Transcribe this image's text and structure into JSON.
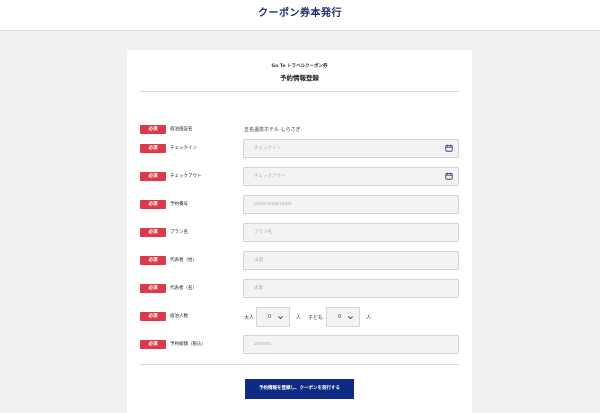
{
  "header": {
    "title": "クーポン券本発行"
  },
  "card": {
    "subtitle": "Go To トラベルクーポン券",
    "title": "予約情報登録"
  },
  "required_label": "必須",
  "fields": {
    "facility": {
      "label": "宿泊施設名",
      "value": "五名温泉ホテル しらさぎ"
    },
    "checkin": {
      "label": "チェックイン",
      "placeholder": "チェックイン",
      "icon": "calendar-icon"
    },
    "checkout": {
      "label": "チェックアウト",
      "placeholder": "チェックアウト",
      "icon": "calendar-icon"
    },
    "reservation_no": {
      "label": "予約番号",
      "placeholder": "0000-0000-0000"
    },
    "plan": {
      "label": "プラン名",
      "placeholder": "プラン名"
    },
    "rep_last": {
      "label": "代表者（姓）",
      "placeholder": "山田"
    },
    "rep_first": {
      "label": "代表者（名）",
      "placeholder": "太郎"
    },
    "guests": {
      "label": "宿泊人数",
      "adult_label": "大人",
      "adult_value": "0",
      "adult_unit": "人",
      "child_label": "子ども",
      "child_value": "0",
      "child_unit": "人"
    },
    "amount": {
      "label": "予約総額（税込）",
      "placeholder": "200000"
    }
  },
  "submit_label": "予約情報を登録し、クーポンを発行する",
  "colors": {
    "required": "#dc3a4b",
    "primary": "#0f2a85",
    "title": "#1e2b6f"
  }
}
